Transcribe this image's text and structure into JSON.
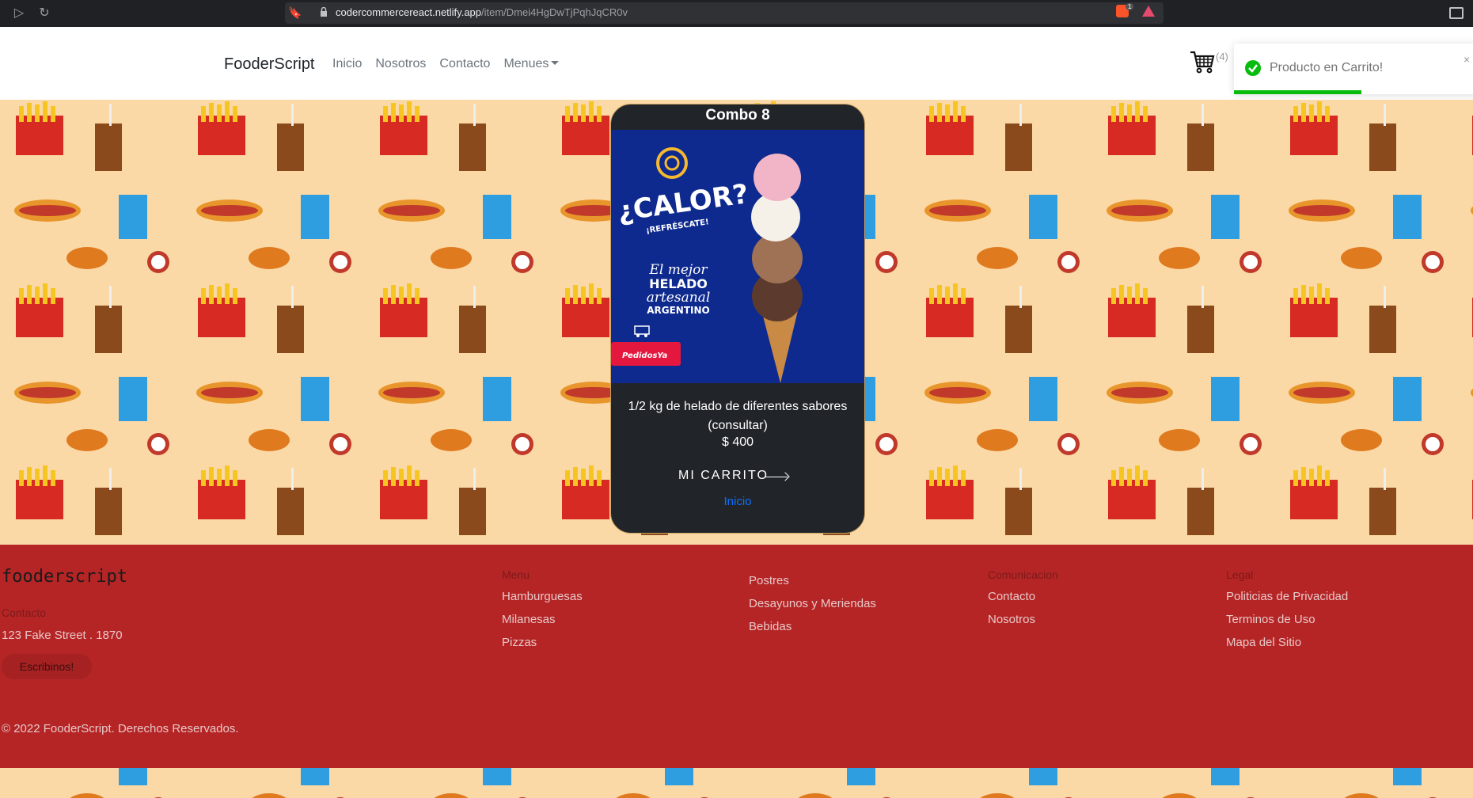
{
  "browser": {
    "url_domain": "codercommercereact.netlify.app",
    "url_path": "/item/Dmei4HgDwTjPqhJqCR0v",
    "brave_badge": "1"
  },
  "navbar": {
    "brand": "FooderScript",
    "links": [
      "Inicio",
      "Nosotros",
      "Contacto",
      "Menues"
    ],
    "cart_count": "(4)"
  },
  "toast": {
    "message": "Producto en Carrito!",
    "close": "×",
    "progress_fraction": 0.52
  },
  "card": {
    "title": "Combo 8",
    "description": "1/2 kg de helado de diferentes sabores (consultar)",
    "price": "$ 400",
    "cart_link": "MI CARRITO",
    "home_link": "Inicio",
    "image": {
      "headline": "¿CALOR?",
      "subheadline": "¡REFRÉSCATE!",
      "lines": [
        "El mejor",
        "HELADO",
        "artesanal",
        "ARGENTINO"
      ],
      "badge": "PedidosYa"
    }
  },
  "footer": {
    "brand": "fooderscript",
    "contact_heading": "Contacto",
    "address": "123 Fake Street . 1870",
    "button": "Escribinos!",
    "columns": [
      {
        "heading": "Menu",
        "links": [
          "Hamburguesas",
          "Milanesas",
          "Pizzas"
        ]
      },
      {
        "heading": "",
        "links": [
          "Postres",
          "Desayunos y Meriendas",
          "Bebidas"
        ]
      },
      {
        "heading": "Comunicacion",
        "links": [
          "Contacto",
          "Nosotros"
        ]
      },
      {
        "heading": "Legal",
        "links": [
          "Politicias de Privacidad",
          "Terminos de Uso",
          "Mapa del Sitio"
        ]
      }
    ],
    "copyright": "© 2022 FooderScript. Derechos Reservados."
  },
  "colors": {
    "footer_bg": "#b52526",
    "pattern_bg": "#fbd9a6",
    "card_bg": "#212529",
    "toast_green": "#07bc0c",
    "link_blue": "#0d6efd"
  }
}
